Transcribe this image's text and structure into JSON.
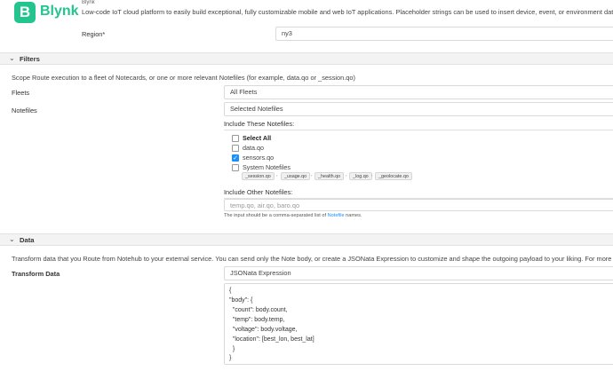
{
  "header": {
    "logo_letter": "B",
    "logo_name": "Blynk",
    "logo_sub": "Blynk",
    "tagline": "Low-code IoT cloud platform to easily build exceptional, fully customizable mobile and web IoT applications. Placeholder strings can be used to insert device, event, or environment data whe"
  },
  "region": {
    "label": "Region*",
    "value": "ny3"
  },
  "filters": {
    "section_title": "Filters",
    "chevron": "⌄",
    "description": "Scope Route execution to a fleet of Notecards, or one or more relevant Notefiles (for example, data.qo or _session.qo)",
    "fleets": {
      "label": "Fleets",
      "value": "All Fleets"
    },
    "notefiles": {
      "label": "Notefiles",
      "value": "Selected Notefiles"
    },
    "include_these_label": "Include These Notefiles:",
    "options": [
      {
        "label": "Select All",
        "checked": false
      },
      {
        "label": "data.qo",
        "checked": false
      },
      {
        "label": "sensors.qo",
        "checked": true
      },
      {
        "label": "System Notefiles",
        "checked": false
      }
    ],
    "system_tags": [
      "_session.qo",
      "_usage.qo",
      "_health.qo",
      "_log.qo",
      "_geolocate.qo"
    ],
    "tag_separator": ",",
    "include_other_label": "Include Other Notefiles:",
    "other_placeholder": "temp.qo, air.qo, baro.qo",
    "hint_pre": "The input should be a comma-separated list of ",
    "hint_link": "Notefile",
    "hint_post": " names."
  },
  "data_section": {
    "section_title": "Data",
    "chevron": "⌄",
    "description": "Transform data that you Route from Notehub to your external service. You can send only the Note body, or create a JSONata Expression to customize and shape the outgoing payload to your liking. For more informati",
    "transform": {
      "label": "Transform Data",
      "value": "JSONata Expression"
    },
    "code_lines": [
      "{",
      "\"body\": {",
      "  \"count\": body.count,",
      "  \"temp\": body.temp,",
      "  \"voltage\": body.voltage,",
      "  \"location\": [best_lon, best_lat]",
      "  }",
      "}"
    ]
  },
  "colors": {
    "brand": "#23c48e",
    "accent": "#1890ff"
  },
  "icons": {
    "check": "check-icon",
    "chevron": "chevron-down-icon"
  }
}
